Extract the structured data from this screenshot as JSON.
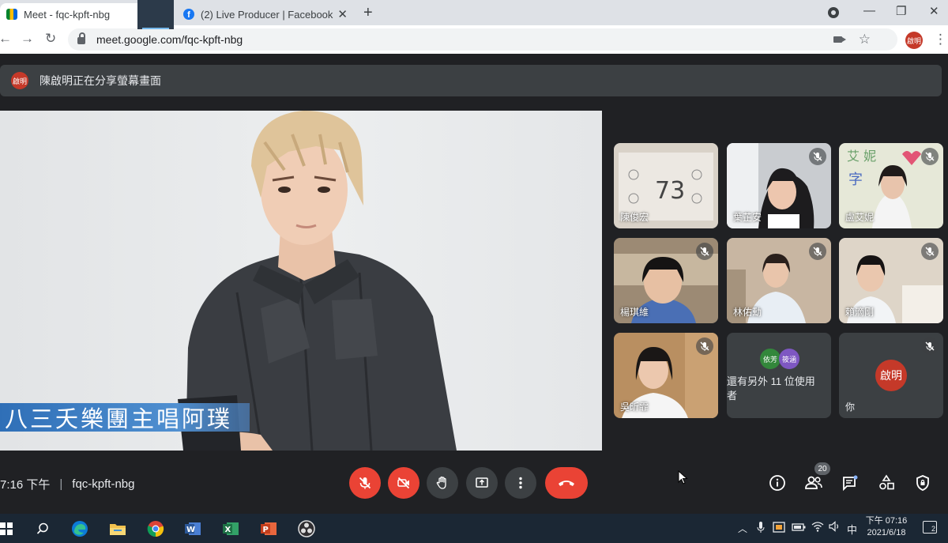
{
  "browser": {
    "tabs": [
      {
        "title": "Meet - fqc-kpft-nbg",
        "active": true,
        "recording": true
      },
      {
        "title": "(2) Live Producer | Facebook",
        "active": false
      }
    ],
    "new_tab_label": "+",
    "url": "meet.google.com/fqc-kpft-nbg",
    "profile_initials": "啟明",
    "window_controls": {
      "minimize": "—",
      "maximize": "❐",
      "close": "✕"
    }
  },
  "banner": {
    "avatar": "啟明",
    "text": "陳啟明正在分享螢幕畫面"
  },
  "presentation": {
    "caption": "八三夭樂團主唱阿璞"
  },
  "participants": [
    {
      "name": "陳俊宏",
      "muted": false
    },
    {
      "name": "葉芷安",
      "muted": true
    },
    {
      "name": "盧艾妮",
      "muted": true
    },
    {
      "name": "楊琪維",
      "muted": true
    },
    {
      "name": "林佑勳",
      "muted": true
    },
    {
      "name": "賴滴剛",
      "muted": true
    },
    {
      "name": "吳昕霏",
      "muted": true
    }
  ],
  "others_tile": {
    "avatars": [
      {
        "label": "依芳",
        "color": "#33873b"
      },
      {
        "label": "筱涵",
        "color": "#7e57c2"
      }
    ],
    "text": "還有另外 11 位使用者"
  },
  "self_tile": {
    "avatar": "啟明",
    "name": "你"
  },
  "meeting": {
    "time": "7:16 下午",
    "separator": "|",
    "code": "fqc-kpft-nbg",
    "participant_count": "20"
  },
  "taskbar": {
    "ime": "中",
    "time": "下午 07:16",
    "date": "2021/6/18",
    "notifications": "2"
  },
  "colors": {
    "meet_bg": "#202124",
    "danger": "#ea4335",
    "control_bg": "#3c4043",
    "avatar_red": "#c53929"
  }
}
